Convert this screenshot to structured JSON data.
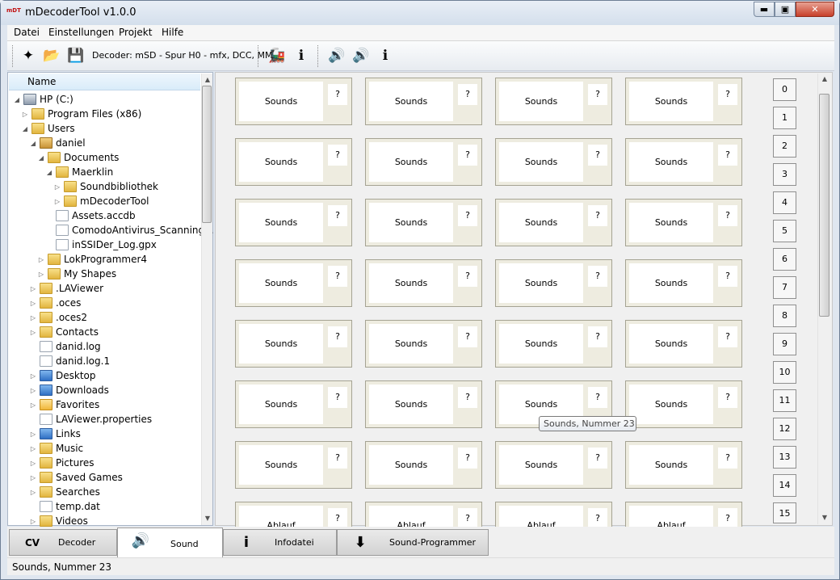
{
  "window": {
    "title": "mDecoderTool v1.0.0",
    "app_icon_text": "mDT",
    "min_glyph": "▬",
    "max_glyph": "▣",
    "close_glyph": "✕"
  },
  "menu": [
    {
      "label": "Datei"
    },
    {
      "label": "Einstellungen"
    },
    {
      "label": "Projekt"
    },
    {
      "label": "Hilfe"
    }
  ],
  "toolbar": {
    "decoder_label": "Decoder: mSD - Spur H0 - mfx, DCC, MM",
    "icons": {
      "new": "✦",
      "open": "📂",
      "save": "💾",
      "loco_load": "🚂",
      "loco_info": "ℹ",
      "sound_tool": "🔊",
      "sound_load": "🔊",
      "sound_info": "ℹ"
    }
  },
  "tree": {
    "header": "Name",
    "rows": [
      {
        "label": "HP (C:)",
        "tog": "◢",
        "icon": "drive"
      },
      {
        "label": "Program Files (x86)",
        "tog": "▷",
        "icon": "folder"
      },
      {
        "label": "Users",
        "tog": "◢",
        "icon": "folder"
      },
      {
        "label": "daniel",
        "tog": "◢",
        "icon": "user"
      },
      {
        "label": "Documents",
        "tog": "◢",
        "icon": "folder"
      },
      {
        "label": "Maerklin",
        "tog": "◢",
        "icon": "folder"
      },
      {
        "label": "Soundbibliothek",
        "tog": "▷",
        "icon": "folder"
      },
      {
        "label": "mDecoderTool",
        "tog": "▷",
        "icon": "folder"
      },
      {
        "label": "Assets.accdb",
        "tog": "",
        "icon": "file"
      },
      {
        "label": "ComodoAntivirus_Scanning...",
        "tog": "",
        "icon": "file"
      },
      {
        "label": "inSSIDer_Log.gpx",
        "tog": "",
        "icon": "file"
      },
      {
        "label": "LokProgrammer4",
        "tog": "▷",
        "icon": "folder"
      },
      {
        "label": "My Shapes",
        "tog": "▷",
        "icon": "folder"
      },
      {
        "label": ".LAViewer",
        "tog": "▷",
        "icon": "folder"
      },
      {
        "label": ".oces",
        "tog": "▷",
        "icon": "folder"
      },
      {
        "label": ".oces2",
        "tog": "▷",
        "icon": "folder"
      },
      {
        "label": "Contacts",
        "tog": "▷",
        "icon": "folder"
      },
      {
        "label": "danid.log",
        "tog": "",
        "icon": "file"
      },
      {
        "label": "danid.log.1",
        "tog": "",
        "icon": "file"
      },
      {
        "label": "Desktop",
        "tog": "▷",
        "icon": "blue"
      },
      {
        "label": "Downloads",
        "tog": "▷",
        "icon": "blue"
      },
      {
        "label": "Favorites",
        "tog": "▷",
        "icon": "star"
      },
      {
        "label": "LAViewer.properties",
        "tog": "",
        "icon": "file"
      },
      {
        "label": "Links",
        "tog": "▷",
        "icon": "blue"
      },
      {
        "label": "Music",
        "tog": "▷",
        "icon": "folder"
      },
      {
        "label": "Pictures",
        "tog": "▷",
        "icon": "folder"
      },
      {
        "label": "Saved Games",
        "tog": "▷",
        "icon": "folder"
      },
      {
        "label": "Searches",
        "tog": "▷",
        "icon": "folder"
      },
      {
        "label": "temp.dat",
        "tog": "",
        "icon": "file"
      },
      {
        "label": "Videos",
        "tog": "▷",
        "icon": "folder"
      }
    ]
  },
  "grid": {
    "rows": [
      [
        "Sounds",
        "Sounds",
        "Sounds",
        "Sounds"
      ],
      [
        "Sounds",
        "Sounds",
        "Sounds",
        "Sounds"
      ],
      [
        "Sounds",
        "Sounds",
        "Sounds",
        "Sounds"
      ],
      [
        "Sounds",
        "Sounds",
        "Sounds",
        "Sounds"
      ],
      [
        "Sounds",
        "Sounds",
        "Sounds",
        "Sounds"
      ],
      [
        "Sounds",
        "Sounds",
        "Sounds",
        "Sounds"
      ],
      [
        "Sounds",
        "Sounds",
        "Sounds",
        "Sounds"
      ],
      [
        "Ablauf",
        "Ablauf",
        "Ablauf",
        "Ablauf"
      ]
    ],
    "q_label": "?",
    "numbers": [
      "0",
      "1",
      "2",
      "3",
      "4",
      "5",
      "6",
      "7",
      "8",
      "9",
      "10",
      "11",
      "12",
      "13",
      "14",
      "15"
    ],
    "tooltip": "Sounds, Nummer 23"
  },
  "tabs": [
    {
      "label": "Decoder",
      "icon": "CV"
    },
    {
      "label": "Sound",
      "icon": "🔊"
    },
    {
      "label": "Infodatei",
      "icon": "i"
    },
    {
      "label": "Sound-Programmer",
      "icon": "⬇"
    }
  ],
  "status": {
    "text": "Sounds, Nummer 23"
  }
}
